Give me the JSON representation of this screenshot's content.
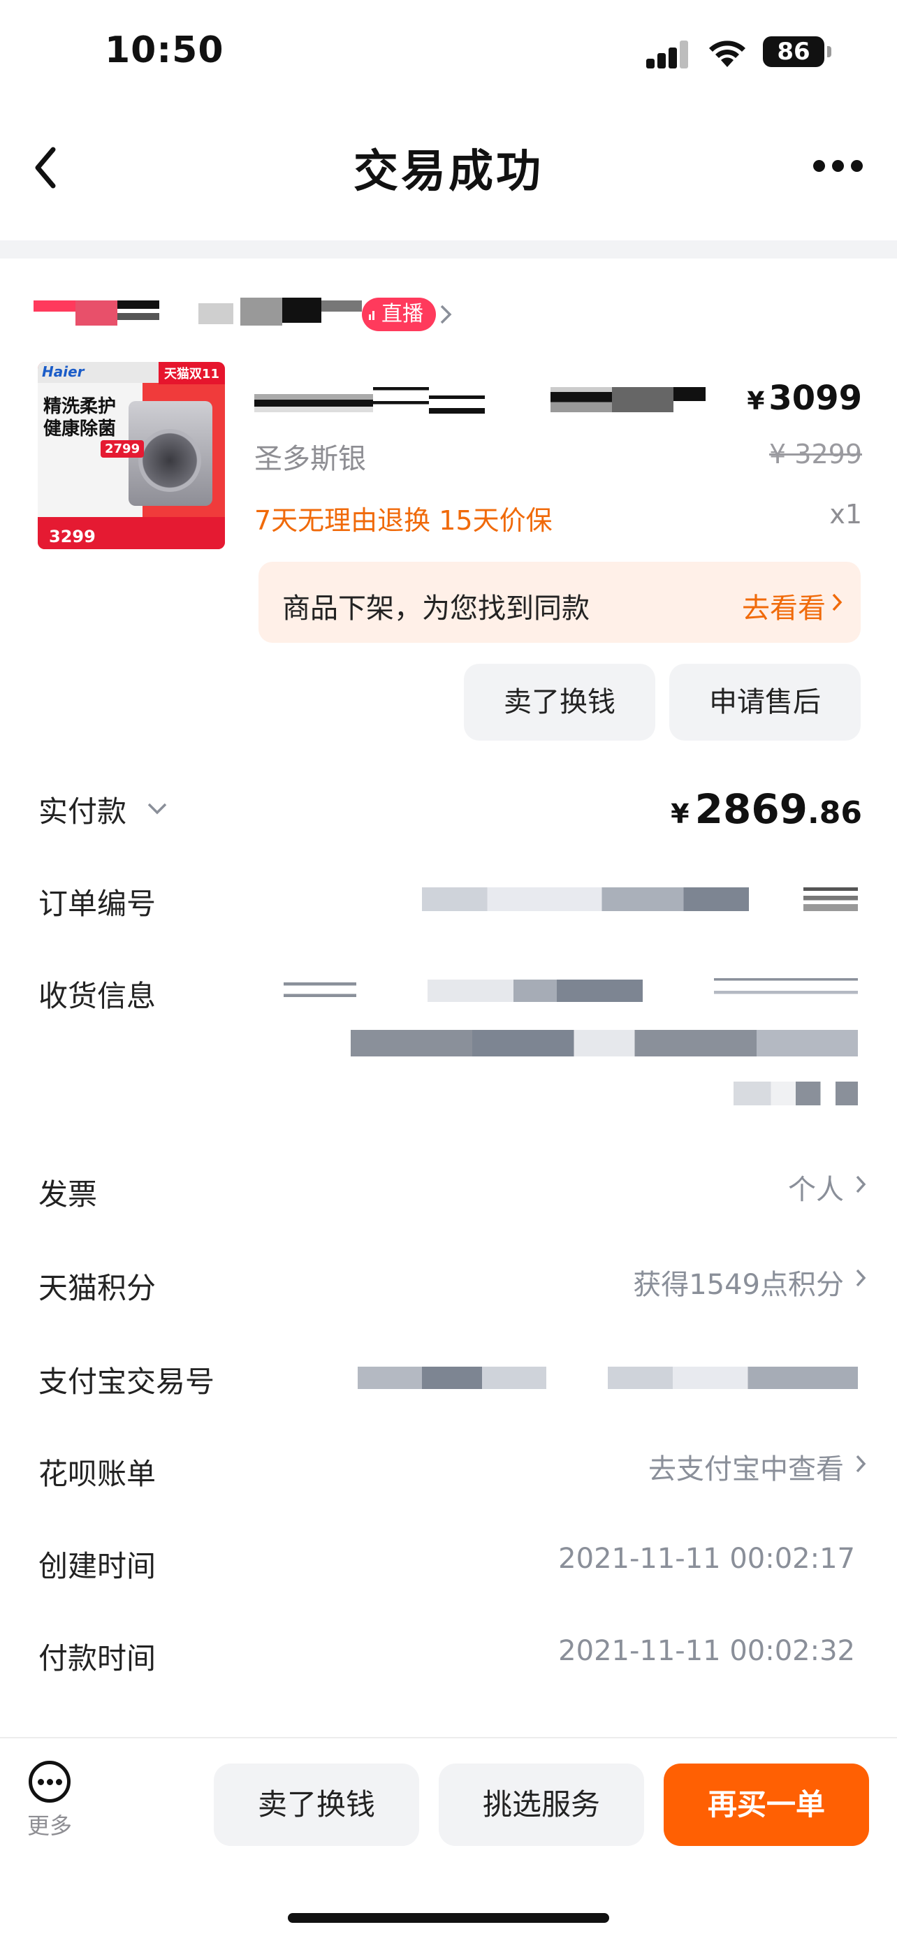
{
  "status_bar": {
    "time": "10:50",
    "battery": "86"
  },
  "nav": {
    "title": "交易成功"
  },
  "shop": {
    "live_badge": "直播"
  },
  "product": {
    "image_text": {
      "brand": "Haier",
      "tmall": "天猫双11",
      "title_line1": "精洗柔护",
      "title_line2": "健康除菌",
      "mid_price": "2799",
      "bottom_price": "3299"
    },
    "price_symbol": "¥",
    "price": "3099",
    "spec": "圣多斯银",
    "original_price": "¥ 3299",
    "tags": "7天无理由退换  15天价保",
    "quantity": "x1"
  },
  "notice": {
    "text": "商品下架，为您找到同款",
    "link": "去看看"
  },
  "actions": {
    "sell_label": "卖了换钱",
    "after_sale_label": "申请售后"
  },
  "payment": {
    "label": "实付款",
    "symbol": "¥",
    "integer": "2869",
    "decimal": ".86"
  },
  "rows": {
    "order_no": "订单编号",
    "shipping": "收货信息",
    "invoice": {
      "label": "发票",
      "value": "个人"
    },
    "points": {
      "label": "天猫积分",
      "value": "获得1549点积分"
    },
    "alipay_no": "支付宝交易号",
    "huabei": {
      "label": "花呗账单",
      "value": "去支付宝中查看"
    },
    "created": {
      "label": "创建时间",
      "value": "2021-11-11 00:02:17"
    },
    "paid": {
      "label": "付款时间",
      "value": "2021-11-11 00:02:32"
    }
  },
  "bottom_bar": {
    "more_label": "更多",
    "sell_label": "卖了换钱",
    "service_label": "挑选服务",
    "rebuy_label": "再买一单"
  },
  "colors": {
    "accent_orange": "#ff6003",
    "tag_orange": "#f06a0a",
    "live_red": "#ff3a5c"
  }
}
